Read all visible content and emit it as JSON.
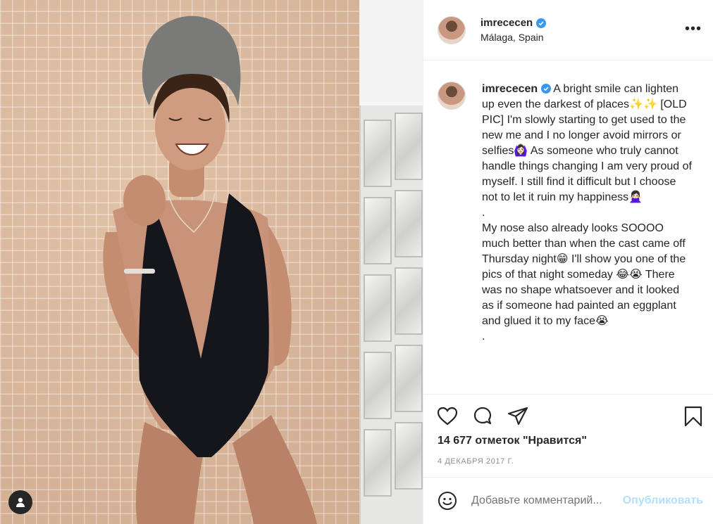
{
  "photo": {
    "icons": {
      "user_tag": "user-silhouette-icon"
    }
  },
  "header": {
    "username": "imrececen",
    "location": "Málaga, Spain",
    "verified_icon": "verified-badge-icon",
    "more_icon": "more-options-icon",
    "more_label": "•••"
  },
  "caption": {
    "username": "imrececen",
    "text": "A bright smile can lighten up even the darkest of places✨✨ [OLD PIC] I'm slowly starting to get used to the new me and I no longer avoid mirrors or selfies🙆🏻‍♀️ As someone who truly cannot handle things changing I am very proud of myself. I still find it difficult but I choose not to let it ruin my happiness🙅🏻‍♀️\n.\nMy nose also already looks SOOOO much better than when the cast came off Thursday night😁 I'll show you one of the pics of that night someday 😂😭 There was no shape whatsoever and it looked as if someone had painted an eggplant and glued it to my face😭\n."
  },
  "actions": {
    "like_icon": "heart-icon",
    "comment_icon": "comment-bubble-icon",
    "share_icon": "paper-plane-icon",
    "save_icon": "bookmark-icon"
  },
  "likes_text": "14 677 отметок \"Нравится\"",
  "date_text": "4 ДЕКАБРЯ 2017 Г.",
  "comment": {
    "emoji_icon": "smiley-face-icon",
    "placeholder": "Добавьте комментарий...",
    "post_label": "Опубликовать"
  },
  "colors": {
    "text": "#262626",
    "muted": "#8e8e8e",
    "verified": "#3897f0",
    "post_disabled": "#b2dffc",
    "border": "#efefef"
  }
}
